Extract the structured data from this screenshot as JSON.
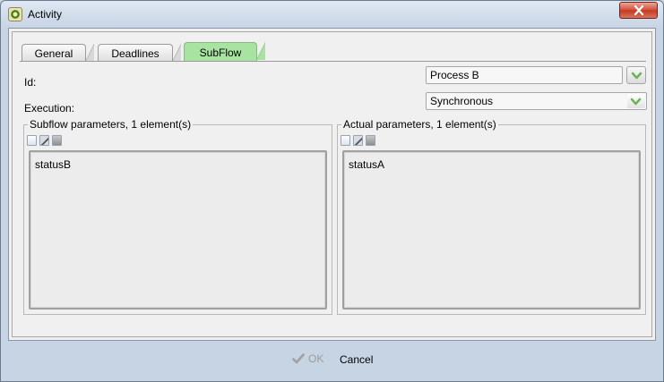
{
  "window": {
    "title": "Activity"
  },
  "tabs": [
    {
      "label": "General"
    },
    {
      "label": "Deadlines"
    },
    {
      "label": "SubFlow",
      "active": true
    }
  ],
  "form": {
    "id_label": "Id:",
    "id_value": "Process B",
    "execution_label": "Execution:",
    "execution_value": "Synchronous"
  },
  "subflow_params": {
    "title": "Subflow parameters, 1 element(s)",
    "items": [
      "statusB"
    ]
  },
  "actual_params": {
    "title": "Actual parameters, 1 element(s)",
    "items": [
      "statusA"
    ]
  },
  "buttons": {
    "ok": "OK",
    "cancel": "Cancel"
  },
  "colors": {
    "active_tab": "#a8e3a2",
    "chevron": "#6cb35a"
  }
}
